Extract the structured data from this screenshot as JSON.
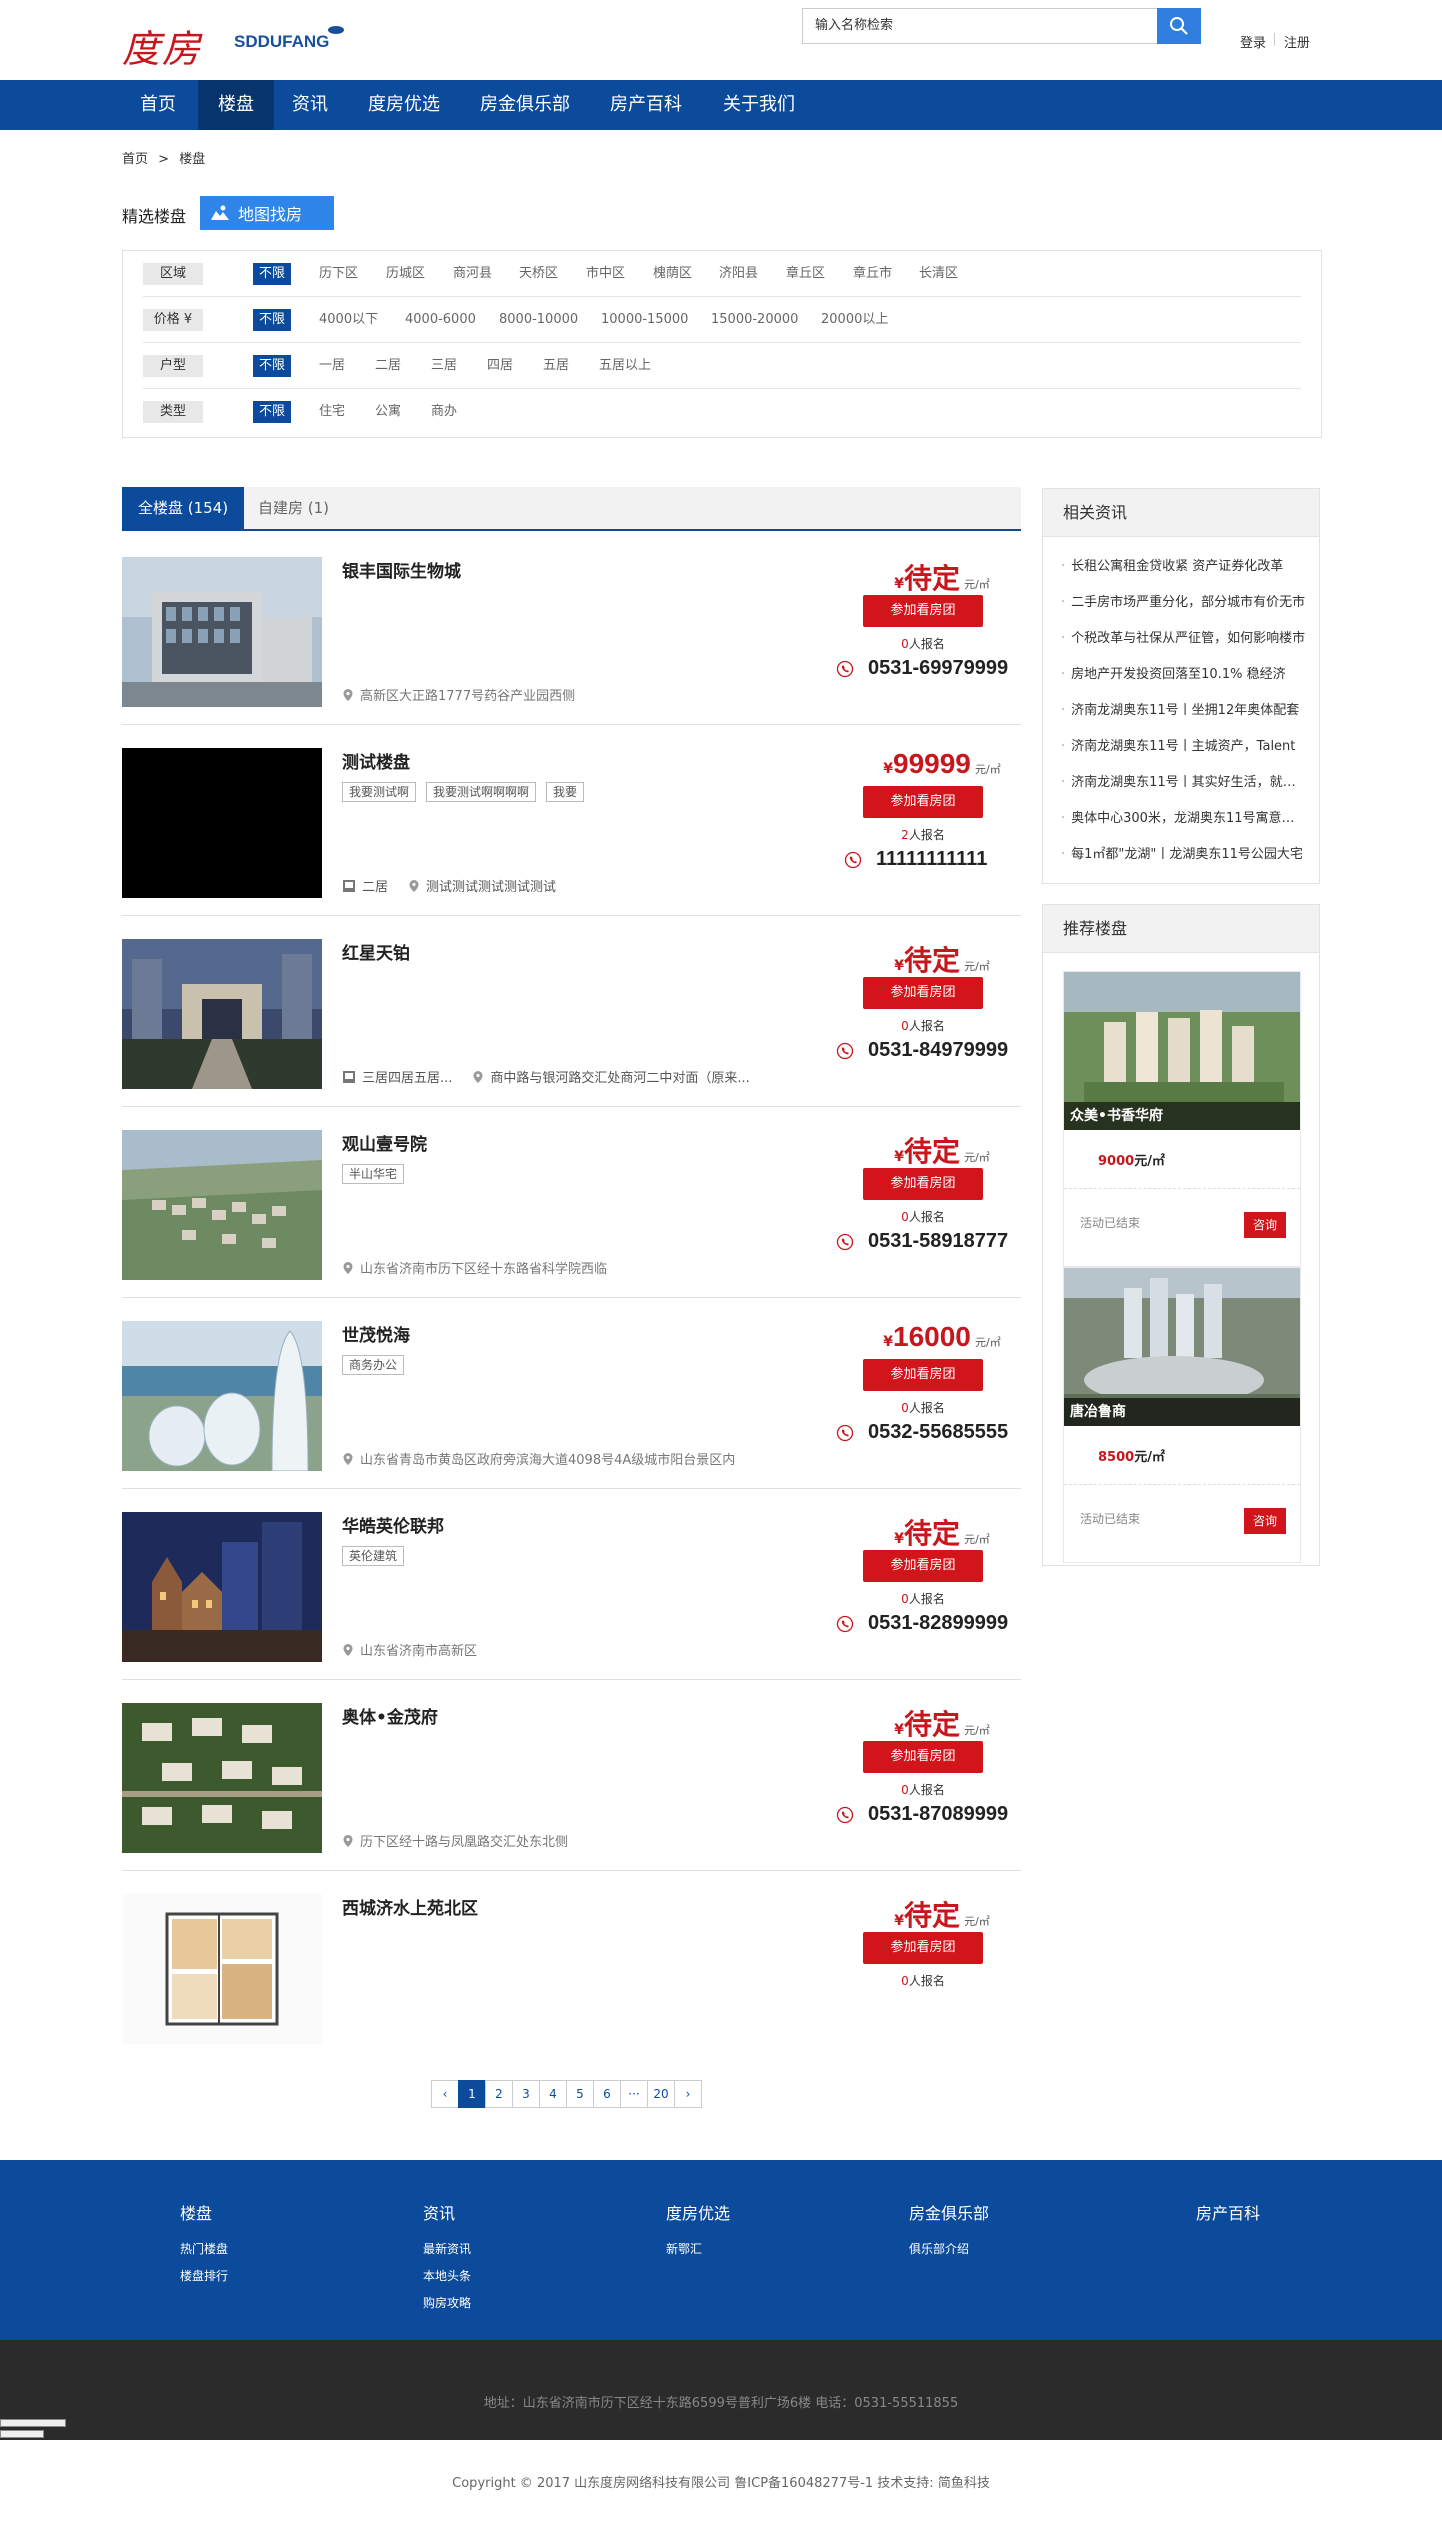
{
  "header": {
    "logo_cn": "度房",
    "logo_en": "SDDUFANG",
    "search_placeholder": "输入名称检索",
    "login": "登录",
    "register": "注册"
  },
  "nav": [
    "首页",
    "楼盘",
    "资讯",
    "度房优选",
    "房金俱乐部",
    "房产百科",
    "关于我们"
  ],
  "nav_active": "楼盘",
  "breadcrumb": {
    "home": "首页",
    "sep": ">",
    "current": "楼盘"
  },
  "selection": {
    "title": "精选楼盘",
    "map_button": "地图找房"
  },
  "filters": [
    {
      "label": "区域",
      "options": [
        "不限",
        "历下区",
        "历城区",
        "商河县",
        "天桥区",
        "市中区",
        "槐荫区",
        "济阳县",
        "章丘区",
        "章丘市",
        "长清区"
      ]
    },
    {
      "label": "价格 ¥",
      "options": [
        "不限",
        "4000以下",
        "4000-6000",
        "8000-10000",
        "10000-15000",
        "15000-20000",
        "20000以上"
      ]
    },
    {
      "label": "户型",
      "options": [
        "不限",
        "一居",
        "二居",
        "三居",
        "四居",
        "五居",
        "五居以上"
      ]
    },
    {
      "label": "类型",
      "options": [
        "不限",
        "住宅",
        "公寓",
        "商办"
      ]
    }
  ],
  "tabs": [
    "全楼盘 (154)",
    "自建房 (1)"
  ],
  "currency": "¥",
  "unit": "元/㎡",
  "join_label": "参加看房团",
  "signed_suffix": "人报名",
  "listings": [
    {
      "name": "银丰国际生物城",
      "tags": [],
      "layout": "",
      "address": "高新区大正路1777号药谷产业园西侧",
      "price": "待定",
      "signed": "0",
      "tel": "0531-69979999",
      "img": "building"
    },
    {
      "name": "测试楼盘",
      "tags": [
        "我要测试啊",
        "我要测试啊啊啊啊",
        "我要"
      ],
      "layout": "二居",
      "address": "测试测试测试测试测试",
      "price": "99999",
      "signed": "2",
      "tel": "11111111111",
      "img": "black"
    },
    {
      "name": "红星天铂",
      "tags": [],
      "layout": "三居四居五居...",
      "address": "商中路与银河路交汇处商河二中对面（原来...",
      "price": "待定",
      "signed": "0",
      "tel": "0531-84979999",
      "img": "gate"
    },
    {
      "name": "观山壹号院",
      "tags": [
        "半山华宅"
      ],
      "layout": "",
      "address": "山东省济南市历下区经十东路省科学院西临",
      "price": "待定",
      "signed": "0",
      "tel": "0531-58918777",
      "img": "aerial"
    },
    {
      "name": "世茂悦海",
      "tags": [
        "商务办公"
      ],
      "layout": "",
      "address": "山东省青岛市黄岛区政府旁滨海大道4098号4A级城市阳台景区内",
      "price": "16000",
      "signed": "0",
      "tel": "0532-55685555",
      "img": "towers"
    },
    {
      "name": "华皓英伦联邦",
      "tags": [
        "英伦建筑"
      ],
      "layout": "",
      "address": "山东省济南市高新区",
      "price": "待定",
      "signed": "0",
      "tel": "0531-82899999",
      "img": "night"
    },
    {
      "name": "奥体•金茂府",
      "tags": [],
      "layout": "",
      "address": "历下区经十路与凤凰路交汇处东北侧",
      "price": "待定",
      "signed": "0",
      "tel": "0531-87089999",
      "img": "topview"
    },
    {
      "name": "西城济水上苑北区",
      "tags": [],
      "layout": "",
      "address": "",
      "price": "待定",
      "signed": "0",
      "tel": "",
      "img": "floorplan"
    }
  ],
  "pager": [
    "‹",
    "1",
    "2",
    "3",
    "4",
    "5",
    "6",
    "···",
    "20",
    "›"
  ],
  "pager_active": "1",
  "sidebar": {
    "news_title": "相关资讯",
    "news": [
      "长租公寓租金贷收紧 资产证券化改革",
      "二手房市场严重分化，部分城市有价无市",
      "个税改革与社保从严征管，如何影响楼市",
      "房地产开发投资回落至10.1% 稳经济",
      "济南龙湖奥东11号丨坐拥12年奥体配套",
      "济南龙湖奥东11号丨主城资产，Talent",
      "济南龙湖奥东11号丨其实好生活，就在身边",
      "奥体中心300米，龙湖奥东11号寓意美好",
      "每1㎡都\"龙湖\"丨龙湖奥东11号公园大宅"
    ],
    "rec_title": "推荐楼盘",
    "recs": [
      {
        "name": "众美•书香华府",
        "price": "9000",
        "unit": "元/㎡",
        "status": "活动已结束",
        "button": "咨询"
      },
      {
        "name": "唐冶鲁商",
        "price": "8500",
        "unit": "元/㎡",
        "status": "活动已结束",
        "button": "咨询"
      }
    ]
  },
  "footer": {
    "cols": [
      {
        "title": "楼盘",
        "links": [
          "热门楼盘",
          "楼盘排行"
        ]
      },
      {
        "title": "资讯",
        "links": [
          "最新资讯",
          "本地头条",
          "购房攻略"
        ]
      },
      {
        "title": "度房优选",
        "links": [
          "新鄂汇"
        ]
      },
      {
        "title": "房金俱乐部",
        "links": [
          "俱乐部介绍"
        ]
      },
      {
        "title": "房产百科",
        "links": []
      }
    ],
    "address": "地址：山东省济南市历下区经十东路6599号普利广场6楼 电话：0531-55511855",
    "copyright": "Copyright © 2017 山东度房网络科技有限公司 鲁ICP备16048277号-1 技术支持: 简鱼科技"
  },
  "colors": {
    "brand_blue": "#0c4b9c",
    "accent_red": "#d2141b",
    "search_blue": "#2f7ee0"
  }
}
